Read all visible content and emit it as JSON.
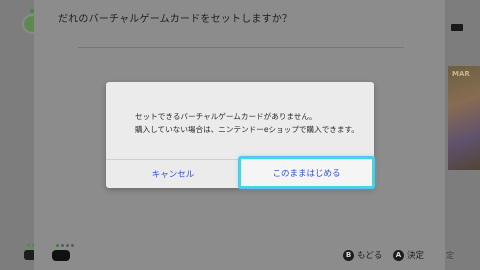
{
  "background": {
    "game_tile_text": "MAR"
  },
  "panel": {
    "title": "だれのバーチャルゲームカードをセットしますか？"
  },
  "dialog": {
    "message_line1": "セットできるバーチャルゲームカードがありません。",
    "message_line2": "購入していない場合は、ニンテンドーeショップで購入できます。",
    "cancel_label": "キャンセル",
    "continue_label": "このままはじめる"
  },
  "footer": {
    "back_button_glyph": "B",
    "back_label": "もどる",
    "ok_button_glyph": "A",
    "ok_label": "決定",
    "bg_hint_label": "定"
  },
  "colors": {
    "accent_text": "#2b4fd6",
    "focus_ring": "#35e0d8",
    "controller_led": "#2c8a2c"
  }
}
